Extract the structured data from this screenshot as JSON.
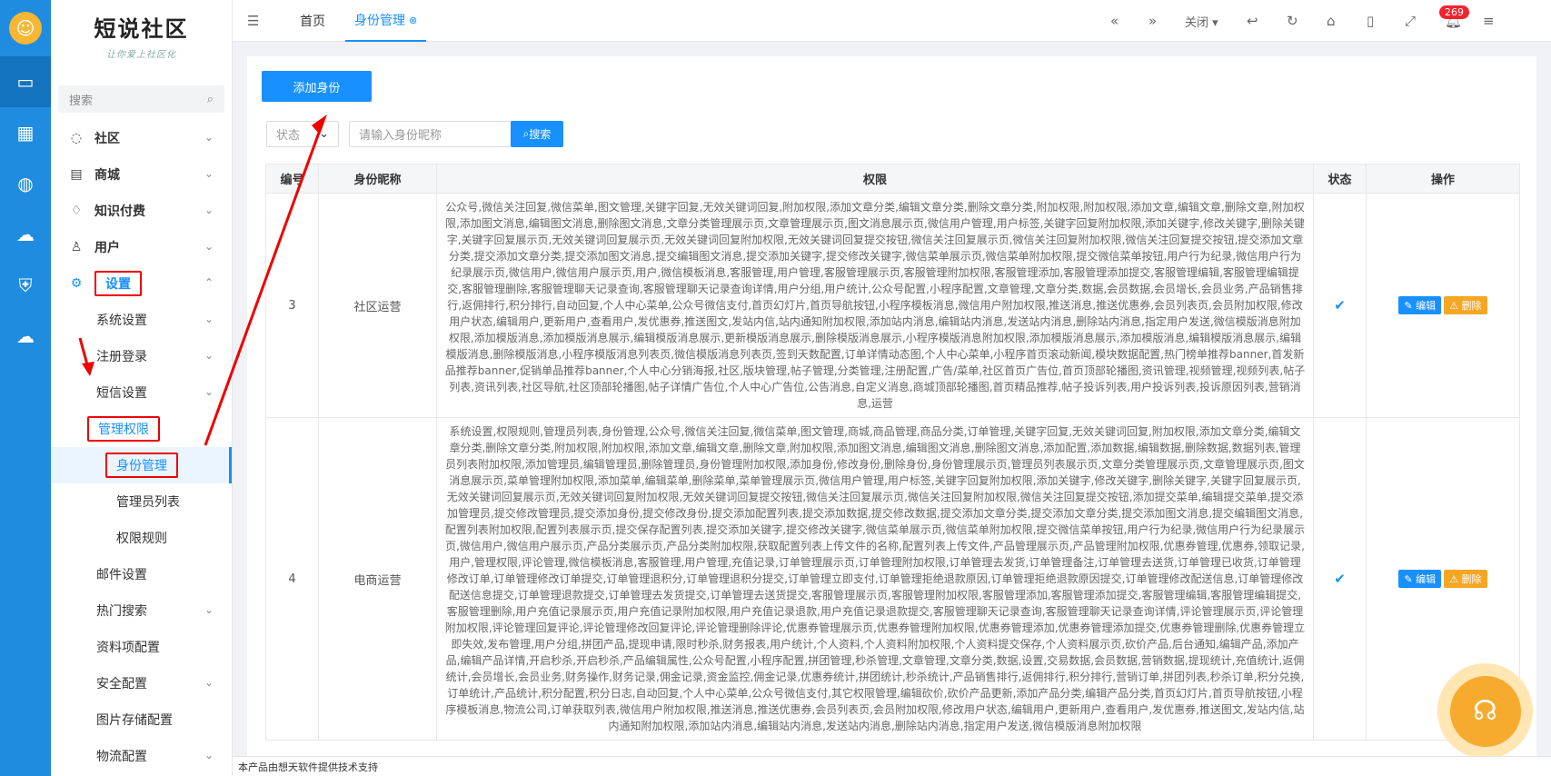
{
  "brand": {
    "title": "短说社区",
    "slogan": "让你爱上社区化"
  },
  "sidebar": {
    "search_placeholder": "搜索",
    "items": [
      {
        "label": "社区",
        "icon": "chat-icon"
      },
      {
        "label": "商城",
        "icon": "shop-icon"
      },
      {
        "label": "知识付费",
        "icon": "bulb-icon"
      },
      {
        "label": "用户",
        "icon": "user-icon"
      },
      {
        "label": "设置",
        "icon": "gear-icon"
      },
      {
        "label": "系统设置"
      },
      {
        "label": "注册登录"
      },
      {
        "label": "短信设置"
      },
      {
        "label": "管理权限"
      },
      {
        "label": "身份管理"
      },
      {
        "label": "管理员列表"
      },
      {
        "label": "权限规则"
      },
      {
        "label": "邮件设置"
      },
      {
        "label": "热门搜索"
      },
      {
        "label": "资料项配置"
      },
      {
        "label": "安全配置"
      },
      {
        "label": "图片存储配置"
      },
      {
        "label": "物流配置"
      }
    ]
  },
  "topbar": {
    "tabs": [
      "首页",
      "身份管理"
    ],
    "close_label": "关闭",
    "notification_count": "269"
  },
  "toolbar": {
    "add_label": "添加身份",
    "status_placeholder": "状态",
    "nickname_placeholder": "请输入身份昵称",
    "search_label": "搜索"
  },
  "table": {
    "headers": [
      "编号",
      "身份昵称",
      "权限",
      "状态",
      "操作"
    ],
    "edit_label": "编辑",
    "delete_label": "删除",
    "rows": [
      {
        "id": "3",
        "name": "社区运营",
        "perm": "公众号,微信关注回复,微信菜单,图文管理,关键字回复,无效关键词回复,附加权限,添加文章分类,编辑文章分类,删除文章分类,附加权限,附加权限,添加文章,编辑文章,删除文章,附加权限,添加图文消息,编辑图文消息,删除图文消息,文章分类管理展示页,文章管理展示页,图文消息展示页,微信用户管理,用户标签,关键字回复附加权限,添加关键字,修改关键字,删除关键字,关键字回复展示页,无效关键词回复展示页,无效关键词回复附加权限,无效关键词回复提交按钮,微信关注回复展示页,微信关注回复附加权限,微信关注回复提交按钮,提交添加文章分类,提交添加文章分类,提交添加图文消息,提交编辑图文消息,提交添加关键字,提交修改关键字,微信菜单展示页,微信菜单附加权限,提交微信菜单按钮,用户行为纪录,微信用户行为纪录展示页,微信用户,微信用户展示页,用户,微信模板消息,客服管理,用户管理,客服管理展示页,客服管理附加权限,客服管理添加,客服管理添加提交,客服管理编辑,客服管理编辑提交,客服管理删除,客服管理聊天记录查询,客服管理聊天记录查询详情,用户分组,用户统计,公众号配置,小程序配置,文章管理,文章分类,数据,会员数据,会员增长,会员业务,产品销售排行,返佣排行,积分排行,自动回复,个人中心菜单,公众号微信支付,首页幻灯片,首页导航按钮,小程序模板消息,微信用户附加权限,推送消息,推送优惠券,会员列表页,会员附加权限,修改用户状态,编辑用户,更新用户,查看用户,发优惠券,推送图文,发站内信,站内通知附加权限,添加站内消息,编辑站内消息,发送站内消息,删除站内消息,指定用户发送,微信模版消息附加权限,添加模版消息,添加模版消息展示,编辑模版消息展示,更新模版消息展示,删除模版消息展示,小程序模版消息附加权限,添加模版消息展示,添加模版消息,编辑模版消息展示,编辑模版消息,删除模版消息,小程序模版消息列表页,微信模版消息列表页,签到天数配置,订单详情动态图,个人中心菜单,小程序首页滚动新闻,模块数据配置,热门榜单推荐banner,首发新品推荐banner,促销单品推荐banner,个人中心分销海报,社区,版块管理,帖子管理,分类管理,注册配置,广告/菜单,社区首页广告位,首页顶部轮播图,资讯管理,视频管理,视频列表,帖子列表,资讯列表,社区导航,社区顶部轮播图,帖子详情广告位,个人中心广告位,公告消息,自定义消息,商城顶部轮播图,首页精品推荐,帖子投诉列表,用户投诉列表,投诉原因列表,营销消息,运营"
      },
      {
        "id": "4",
        "name": "电商运营",
        "perm": "系统设置,权限规则,管理员列表,身份管理,公众号,微信关注回复,微信菜单,图文管理,商城,商品管理,商品分类,订单管理,关键字回复,无效关键词回复,附加权限,添加文章分类,编辑文章分类,删除文章分类,附加权限,附加权限,添加文章,编辑文章,删除文章,附加权限,添加图文消息,编辑图文消息,删除图文消息,添加配置,添加数据,编辑数据,删除数据,数据列表,管理员列表附加权限,添加管理员,编辑管理员,删除管理员,身份管理附加权限,添加身份,修改身份,删除身份,身份管理展示页,管理员列表展示页,文章分类管理展示页,文章管理展示页,图文消息展示页,菜单管理附加权限,添加菜单,编辑菜单,删除菜单,菜单管理展示页,微信用户管理,用户标签,关键字回复附加权限,添加关键字,修改关键字,删除关键字,关键字回复展示页,无效关键词回复展示页,无效关键词回复附加权限,无效关键词回复提交按钮,微信关注回复展示页,微信关注回复附加权限,微信关注回复提交按钮,添加提交菜单,编辑提交菜单,提交添加管理员,提交修改管理员,提交添加身份,提交修改身份,提交添加配置列表,提交添加数据,提交修改数据,提交添加文章分类,提交添加文章分类,提交添加图文消息,提交编辑图文消息,配置列表附加权限,配置列表展示页,提交保存配置列表,提交添加关键字,提交修改关键字,微信菜单展示页,微信菜单附加权限,提交微信菜单按钮,用户行为纪录,微信用户行为纪录展示页,微信用户,微信用户展示页,产品分类展示页,产品分类附加权限,获取配置列表上传文件的名称,配置列表上传文件,产品管理展示页,产品管理附加权限,优惠券管理,优惠券,领取记录,用户,管理权限,评论管理,微信模板消息,客服管理,用户管理,充值记录,订单管理展示页,订单管理附加权限,订单管理去发货,订单管理备注,订单管理去送货,订单管理已收货,订单管理修改订单,订单管理修改订单提交,订单管理退积分,订单管理退积分提交,订单管理立即支付,订单管理拒绝退款原因,订单管理拒绝退款原因提交,订单管理修改配送信息,订单管理修改配送信息提交,订单管理退款提交,订单管理去发货提交,订单管理去送货提交,客服管理展示页,客服管理附加权限,客服管理添加,客服管理添加提交,客服管理编辑,客服管理编辑提交,客服管理删除,用户充值记录展示页,用户充值记录附加权限,用户充值记录退款,用户充值记录退款提交,客服管理聊天记录查询,客服管理聊天记录查询详情,评论管理展示页,评论管理附加权限,评论管理回复评论,评论管理修改回复评论,评论管理删除评论,优惠券管理展示页,优惠券管理附加权限,优惠券管理添加,优惠券管理添加提交,优惠券管理删除,优惠券管理立即失效,发布管理,用户分组,拼团产品,提现申请,限时秒杀,财务报表,用户统计,个人资料,个人资料附加权限,个人资料提交保存,个人资料展示页,砍价产品,后台通知,编辑产品,添加产品,编辑产品详情,开启秒杀,开启秒杀,产品编辑属性,公众号配置,小程序配置,拼团管理,秒杀管理,文章管理,文章分类,数据,设置,交易数据,会员数据,营销数据,提现统计,充值统计,返佣统计,会员增长,会员业务,财务操作,财务记录,佣金记录,资金监控,佣金记录,优惠券统计,拼团统计,秒杀统计,产品销售排行,返佣排行,积分排行,营销订单,拼团列表,秒杀订单,积分兑换,订单统计,产品统计,积分配置,积分日志,自动回复,个人中心菜单,公众号微信支付,其它权限管理,编辑砍价,砍价产品更新,添加产品分类,编辑产品分类,首页幻灯片,首页导航按钮,小程序模板消息,物流公司,订单获取列表,微信用户附加权限,推送消息,推送优惠券,会员列表页,会员附加权限,修改用户状态,编辑用户,更新用户,查看用户,发优惠券,推送图文,发站内信,站内通知附加权限,添加站内消息,编辑站内消息,发送站内消息,删除站内消息,指定用户发送,微信模版消息附加权限"
      }
    ]
  },
  "footer": {
    "text": "本产品由想天软件提供技术支持"
  }
}
